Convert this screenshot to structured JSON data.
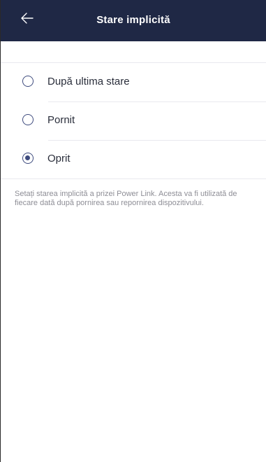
{
  "header": {
    "title": "Stare implicită",
    "back_icon": "arrow-left-icon",
    "background_color": "#1f2845"
  },
  "options": [
    {
      "label": "După ultima stare",
      "selected": false
    },
    {
      "label": "Pornit",
      "selected": false
    },
    {
      "label": "Oprit",
      "selected": true
    }
  ],
  "description": "Setați starea implicită a prizei Power Link. Acesta va fi utilizată de fiecare dată după pornirea sau repornirea dispozitivului.",
  "colors": {
    "accent": "#3e4b7e",
    "text": "#2a2e3b",
    "muted_text": "#8e8e96",
    "divider": "#e9e9ee"
  }
}
